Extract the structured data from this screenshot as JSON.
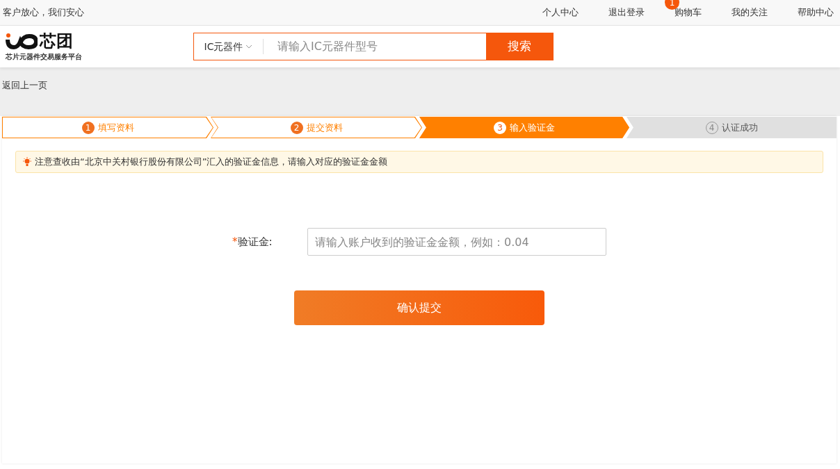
{
  "top_bar": {
    "slogan": "客户放心，我们安心",
    "links": [
      {
        "label": "个人中心"
      },
      {
        "label": "退出登录"
      },
      {
        "label": "购物车",
        "badge": "1"
      },
      {
        "label": "我的关注"
      },
      {
        "label": "帮助中心"
      }
    ]
  },
  "header": {
    "logo": {
      "name": "芯团",
      "tagline": "芯片元器件交易服务平台"
    },
    "search": {
      "category": "IC元器件",
      "placeholder": "请输入IC元器件型号",
      "button": "搜索"
    }
  },
  "back_link": "返回上一页",
  "steps": [
    {
      "number": "1",
      "label": "填写资料",
      "completed": true,
      "selected": false
    },
    {
      "number": "2",
      "label": "提交资料",
      "completed": true,
      "selected": false
    },
    {
      "number": "3",
      "label": "输入验证金",
      "completed": false,
      "selected": true
    },
    {
      "number": "4",
      "label": "认证成功",
      "completed": false,
      "selected": false
    }
  ],
  "notice": "注意查收由“北京中关村银行股份有限公司”汇入的验证金信息，请输入对应的验证金金额",
  "form": {
    "required_mark": "*",
    "label": "验证金:",
    "placeholder": "请输入账户收到的验证金金额，例如：0.04",
    "submit": "确认提交"
  }
}
